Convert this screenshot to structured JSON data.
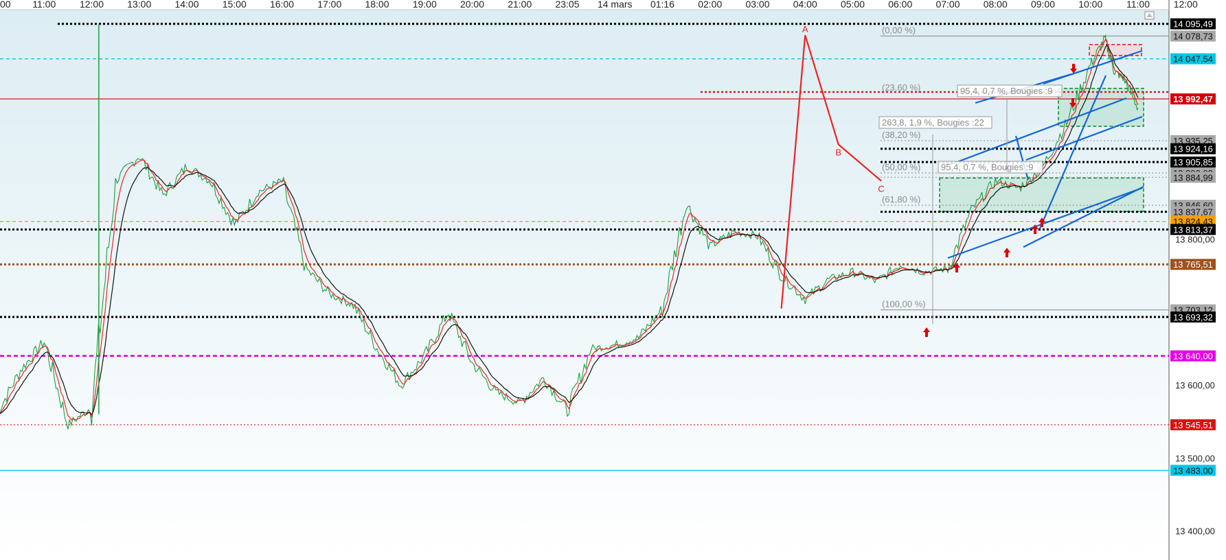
{
  "chart_data": {
    "type": "line",
    "title": "",
    "xlabel": "",
    "ylabel": "",
    "ylim": [
      13360,
      14115
    ],
    "grid": false,
    "time_ticks": [
      "00",
      "11:00",
      "12:00",
      "13:00",
      "14:00",
      "15:00",
      "16:00",
      "17:00",
      "18:00",
      "19:00",
      "20:00",
      "21:00",
      "23:05",
      "14 mars",
      "01:16",
      "02:00",
      "03:00",
      "04:00",
      "05:00",
      "06:00",
      "07:00",
      "08:00",
      "09:00",
      "10:00",
      "11:00",
      "12:00"
    ],
    "price_ticks": [
      "13 800,00",
      "13 600,00",
      "13 500,00",
      "13 400,00"
    ],
    "series": [
      {
        "color": "#1b9e3a",
        "x": [
          0,
          0.5,
          1,
          1.5,
          2,
          2.5,
          3,
          3.5,
          4,
          4.5,
          5,
          5.5,
          6,
          6.5,
          7,
          7.5,
          8,
          8.5,
          9,
          9.5,
          10,
          10.5,
          11,
          11.5,
          12,
          12.5,
          13,
          13.5,
          14,
          14.5,
          15,
          15.5,
          16,
          16.5,
          17,
          17.5,
          18,
          18.5,
          19,
          19.5,
          20,
          20.5,
          21,
          21.5,
          22,
          22.5,
          23,
          23.3,
          23.5,
          23.7,
          24
        ],
        "values": [
          13560,
          13620,
          13660,
          13545,
          13570,
          13880,
          13915,
          13860,
          13900,
          13880,
          13820,
          13865,
          13880,
          13760,
          13725,
          13710,
          13650,
          13600,
          13640,
          13700,
          13630,
          13590,
          13575,
          13610,
          13565,
          13650,
          13655,
          13665,
          13705,
          13850,
          13790,
          13810,
          13805,
          13750,
          13718,
          13745,
          13755,
          13742,
          13765,
          13755,
          13760,
          13840,
          13880,
          13870,
          13900,
          13960,
          14040,
          14075,
          14030,
          14020,
          13980
        ]
      },
      {
        "name": "",
        "color": "#ee2222",
        "values": []
      },
      {
        "name": "",
        "color": "#111111",
        "values": []
      }
    ],
    "horizontal_levels": [
      {
        "label": "14 095,49",
        "value": 14095.49,
        "line_color": "#000000",
        "label_bg": "#000000",
        "label_fg": "#ffffff",
        "dash": "dot-thick"
      },
      {
        "label": "14 078,73",
        "value": 14078.73,
        "line_color": "#999999",
        "label_bg": "#a8a8a8",
        "label_fg": "#111111",
        "dash": "solid"
      },
      {
        "label": "14 047,54",
        "value": 14047.54,
        "line_color": "#00c8e6",
        "label_bg": "#00c8e6",
        "label_fg": "#111111",
        "dash": "dash"
      },
      {
        "label": "13 992,47",
        "value": 13992.47,
        "line_color": "#e01010",
        "label_bg": "#d40000",
        "label_fg": "#ffffff",
        "dash": "solid"
      },
      {
        "label": "13 935,25",
        "value": 13935.25,
        "line_color": "#999999",
        "label_bg": "#a8a8a8",
        "label_fg": "#111111",
        "dash": "dot"
      },
      {
        "label": "13 924,16",
        "value": 13924.16,
        "line_color": "#000000",
        "label_bg": "#000000",
        "label_fg": "#ffffff",
        "dash": "dot-thick"
      },
      {
        "label": "13 905,85",
        "value": 13905.85,
        "line_color": "#000000",
        "label_bg": "#000000",
        "label_fg": "#ffffff",
        "dash": "dot-thick"
      },
      {
        "label": "13 890,92",
        "value": 13890.92,
        "line_color": "#999999",
        "label_bg": "#a8a8a8",
        "label_fg": "#111111",
        "dash": "dot"
      },
      {
        "label": "13 884,99",
        "value": 13884.99,
        "line_color": "#999999",
        "label_bg": "#a8a8a8",
        "label_fg": "#111111",
        "dash": "dot"
      },
      {
        "label": "13 846,60",
        "value": 13846.6,
        "line_color": "#999999",
        "label_bg": "#a8a8a8",
        "label_fg": "#111111",
        "dash": "dot"
      },
      {
        "label": "13 837,67",
        "value": 13837.67,
        "line_color": "#000000",
        "label_bg": "#a8a8a8",
        "label_fg": "#111111",
        "dash": "dot-thick"
      },
      {
        "label": "13 824,43",
        "value": 13824.43,
        "line_color": "#f5a000",
        "label_bg": "#f5a000",
        "label_fg": "#111111",
        "dash": "dash"
      },
      {
        "label": "13 813,37",
        "value": 13813.37,
        "line_color": "#000000",
        "label_bg": "#000000",
        "label_fg": "#ffffff",
        "dash": "dot-thick"
      },
      {
        "label": "13 765,51",
        "value": 13765.51,
        "line_color": "#a0521d",
        "label_bg": "#a0521d",
        "label_fg": "#ffffff",
        "dash": "dot-thick"
      },
      {
        "label": "13 703,12",
        "value": 13703.12,
        "line_color": "#999999",
        "label_bg": "#a8a8a8",
        "label_fg": "#111111",
        "dash": "solid"
      },
      {
        "label": "13 693,32",
        "value": 13693.32,
        "line_color": "#000000",
        "label_bg": "#000000",
        "label_fg": "#ffffff",
        "dash": "dot-thick"
      },
      {
        "label": "13 640,00",
        "value": 13640.0,
        "line_color": "#e600e6",
        "label_bg": "#e600e6",
        "label_fg": "#ffffff",
        "dash": "dash-thick"
      },
      {
        "label": "13 545,51",
        "value": 13545.51,
        "line_color": "#e01010",
        "label_bg": "#e01010",
        "label_fg": "#ffffff",
        "dash": "dot"
      },
      {
        "label": "13 483,00",
        "value": 13483.0,
        "line_color": "#00c8e6",
        "label_bg": "#00c8e6",
        "label_fg": "#111111",
        "dash": "solid"
      }
    ],
    "fibonacci": [
      {
        "label": "(0,00 %)",
        "value": 14078.73
      },
      {
        "label": "(23,60 %)",
        "value": 14000.0
      },
      {
        "label": "(38,20 %)",
        "value": 13935.25
      },
      {
        "label": "(50,00 %)",
        "value": 13890.92
      },
      {
        "label": "(61,80 %)",
        "value": 13846.6
      },
      {
        "label": "(100,00 %)",
        "value": 13703.12
      }
    ],
    "abc_pattern": {
      "points": [
        {
          "label": "A",
          "x": 17.0,
          "y": 14080
        },
        {
          "label": "B",
          "x": 17.7,
          "y": 13930
        },
        {
          "label": "C",
          "x": 18.6,
          "y": 13880
        }
      ],
      "start": {
        "x": 16.5,
        "y": 13705
      },
      "color": "#ee2222"
    },
    "measurements": [
      {
        "label": "95,4, 0,7 %, Bougies :9"
      },
      {
        "label": "263,8, 1,9 %, Bougies :22"
      },
      {
        "label": "95,4, 0,7 %, Bougies :9"
      }
    ]
  }
}
